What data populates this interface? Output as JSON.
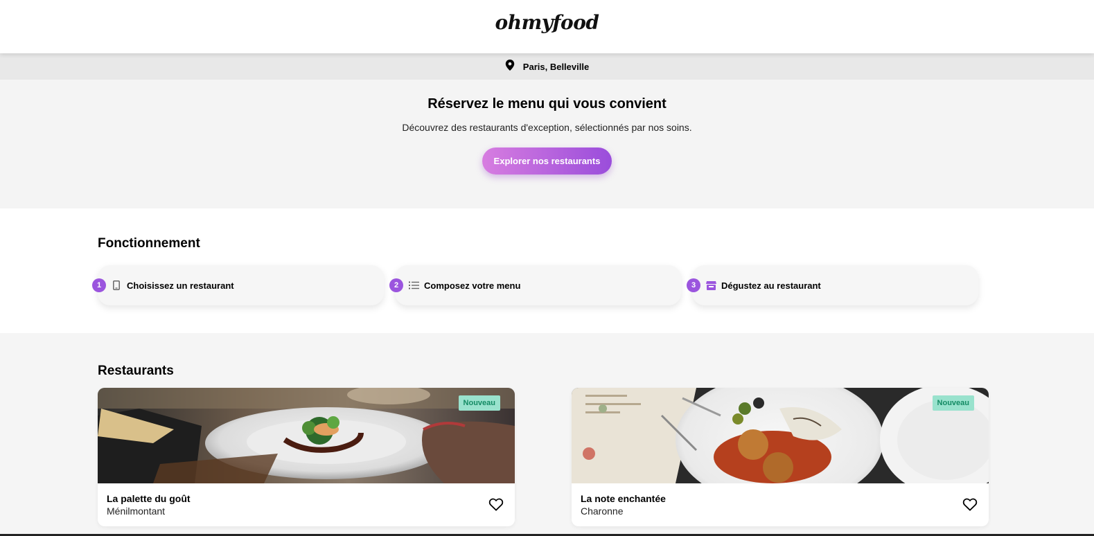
{
  "header": {
    "logo": "ohmyfood"
  },
  "location": {
    "icon": "map-pin-icon",
    "text": "Paris, Belleville"
  },
  "hero": {
    "title": "Réservez le menu qui vous convient",
    "subtitle": "Découvrez des restaurants d'exception, sélectionnés par nos soins.",
    "cta_label": "Explorer nos restaurants"
  },
  "how": {
    "title": "Fonctionnement",
    "steps": [
      {
        "num": "1",
        "icon": "phone-icon",
        "label": "Choisissez un restaurant"
      },
      {
        "num": "2",
        "icon": "list-icon",
        "label": "Composez votre menu"
      },
      {
        "num": "3",
        "icon": "store-icon",
        "label": "Dégustez au restaurant"
      }
    ]
  },
  "restaurants": {
    "title": "Restaurants",
    "items": [
      {
        "name": "La palette du goût",
        "area": "Ménilmontant",
        "badge": "Nouveau"
      },
      {
        "name": "La note enchantée",
        "area": "Charonne",
        "badge": "Nouveau"
      }
    ]
  },
  "colors": {
    "accent": "#9b55de",
    "cta_start": "#d77de0",
    "cta_end": "#9a4ddb",
    "badge_bg": "#99e2cd",
    "badge_text": "#138a63"
  }
}
